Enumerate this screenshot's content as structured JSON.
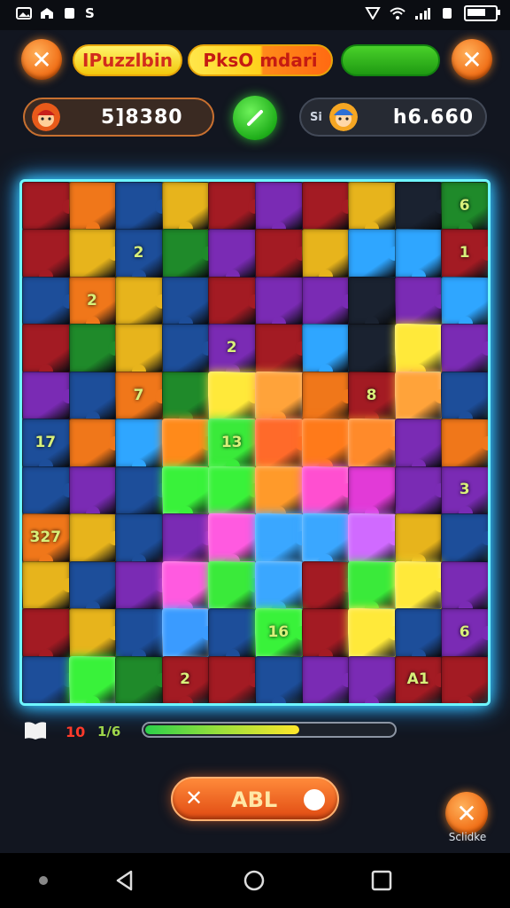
{
  "status_bar": {
    "left_text": "S",
    "battery_level": 0.75
  },
  "header": {
    "close_left_label": "✕",
    "title_pill": "IPuzzlbin",
    "mode_pill": "PksO mdari",
    "close_right_label": "✕"
  },
  "scores": {
    "player_score": "5]8380",
    "opponent_score": "h6.660",
    "opponent_prefix": "Si"
  },
  "board": {
    "tile_labels": [
      "6",
      "2",
      "1",
      "2",
      "7",
      "13",
      "16",
      "6",
      "2",
      "A1",
      "327",
      "3",
      "2",
      "8",
      "17"
    ]
  },
  "bottom": {
    "red_count": "10",
    "green_count": "1/6",
    "progress": 0.62
  },
  "action_button": {
    "label": "ABL"
  },
  "corner": {
    "label": "Sclidke"
  },
  "colors": {
    "board_border": "#6ff6ff",
    "accent_orange": "#f06a12",
    "accent_green": "#1fae1a",
    "accent_yellow": "#ffd21c"
  }
}
